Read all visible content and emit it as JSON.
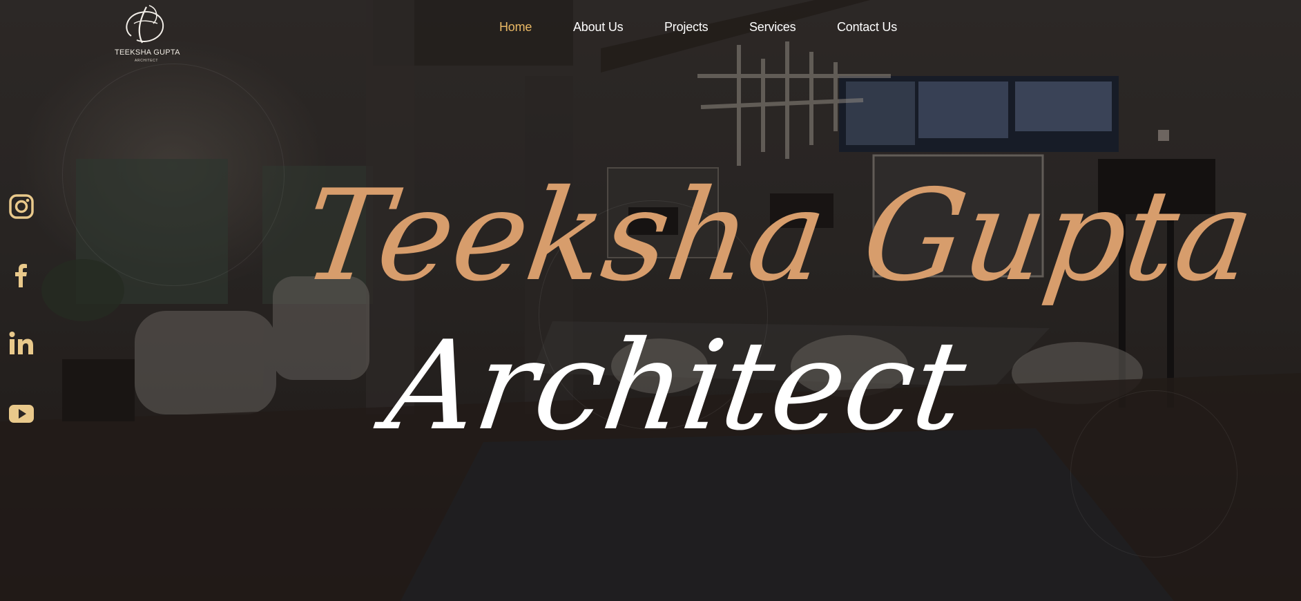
{
  "brand": {
    "name": "TEEKSHA GUPTA",
    "subtitle": "ARCHITECT",
    "accent_color": "#e9b865",
    "headline_color": "#d79d6c"
  },
  "nav": {
    "items": [
      {
        "label": "Home",
        "active": true
      },
      {
        "label": "About Us",
        "active": false
      },
      {
        "label": "Projects",
        "active": false
      },
      {
        "label": "Services",
        "active": false
      },
      {
        "label": "Contact Us",
        "active": false
      }
    ]
  },
  "social": [
    {
      "icon": "instagram-icon"
    },
    {
      "icon": "facebook-icon"
    },
    {
      "icon": "linkedin-icon"
    },
    {
      "icon": "youtube-icon"
    }
  ],
  "hero": {
    "title": "Teeksha Gupta",
    "subtitle": "Architect"
  }
}
